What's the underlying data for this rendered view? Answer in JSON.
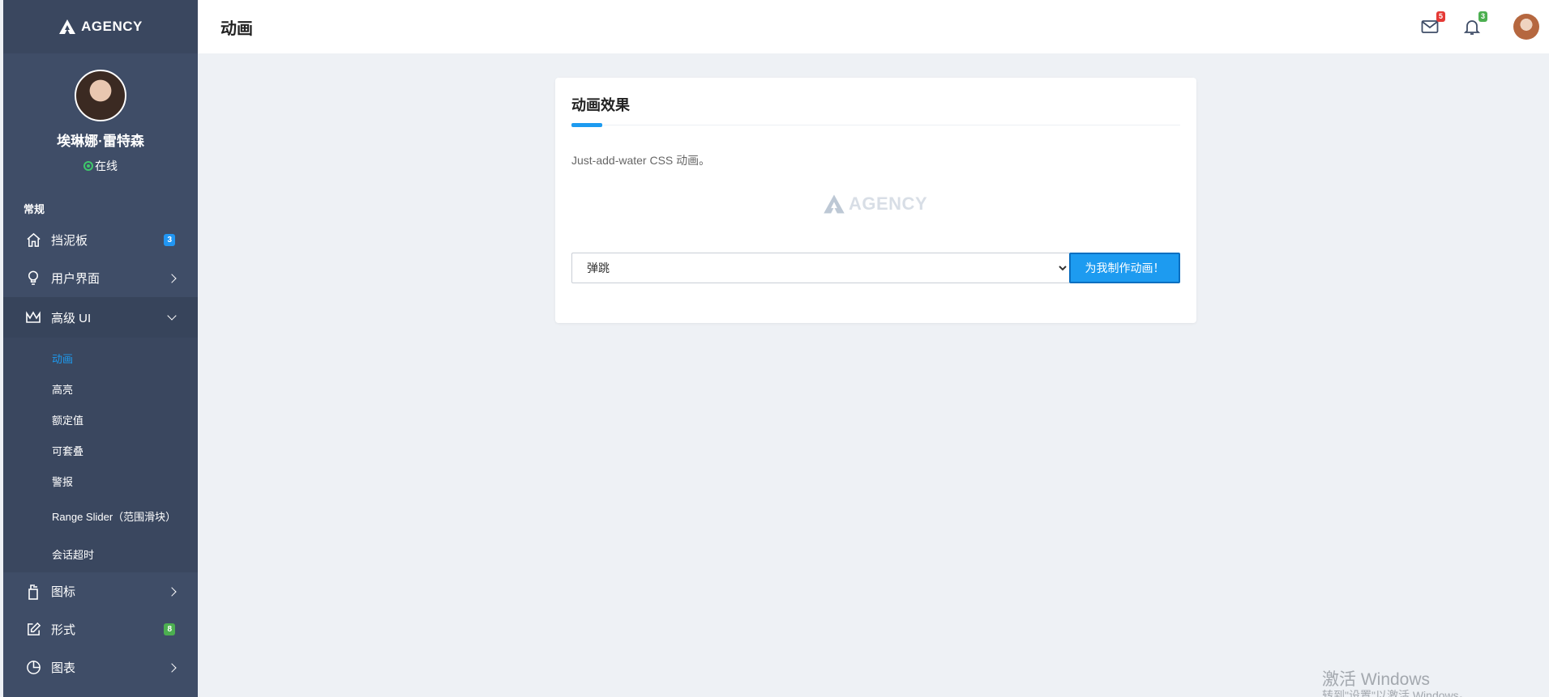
{
  "brand": {
    "name": "AGENCY"
  },
  "profile": {
    "name": "埃琳娜·雷特森",
    "status": "在线"
  },
  "sidebar": {
    "section": "常规",
    "items": [
      {
        "label": "挡泥板",
        "icon": "home-icon",
        "badge": "3"
      },
      {
        "label": "用户界面",
        "icon": "lightbulb-icon"
      },
      {
        "label": "高级 UI",
        "icon": "crown-icon"
      },
      {
        "label": "图标",
        "icon": "gift-icon"
      },
      {
        "label": "形式",
        "icon": "edit-icon",
        "badge": "8"
      },
      {
        "label": "图表",
        "icon": "pie-chart-icon"
      }
    ],
    "submenu": [
      "动画",
      "高亮",
      "额定值",
      "可套叠",
      "警报",
      "Range Slider（范围滑块）",
      "会话超时"
    ]
  },
  "header": {
    "title": "动画",
    "mail_count": "5",
    "bell_count": "3"
  },
  "card": {
    "title": "动画效果",
    "description": "Just-add-water CSS 动画。",
    "logo_text": "AGENCY",
    "select_value": "弹跳",
    "button_label": "为我制作动画！"
  },
  "watermark": {
    "line1": "激活 Windows",
    "line2": "转到\"设置\"以激活 Windows。"
  },
  "colors": {
    "sidebar": "#3f4d67",
    "accent": "#1d9bf0",
    "background": "#eef1f5"
  }
}
